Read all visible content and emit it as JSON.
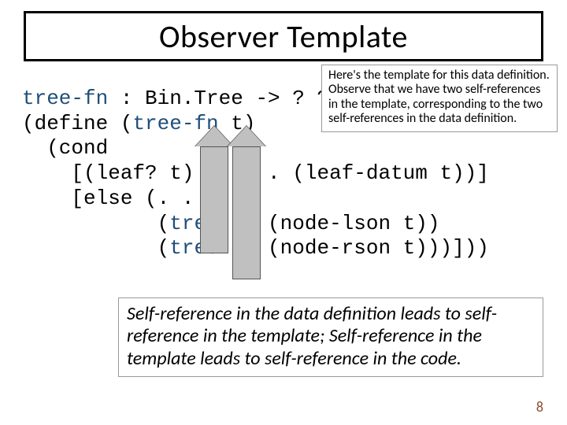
{
  "title": "Observer Template",
  "note": "Here's the template for this data definition.  Observe that we have two self-references in the template, corresponding to the two self-references in the data definition.",
  "code": {
    "sig_fn": "tree-fn",
    "sig_rest": " : Bin.Tree -> ? ? ?",
    "l2a": "(define (",
    "l2b": "tree-fn",
    "l2c": " t)",
    "l3": "  (cond",
    "l4": "    [(leaf? t) (. . . (leaf-datum t))]",
    "l5": "    [else (. . .",
    "l6a": "           (",
    "l6b": "tree-fn",
    "l6c": " (node-lson t))",
    "l7a": "           (",
    "l7b": "tree-fn",
    "l7c": " (node-rson t)))]))"
  },
  "footnote": "Self-reference in the data definition leads to self-reference in the template; Self-reference in the template leads to self-reference in the code.",
  "page": "8"
}
